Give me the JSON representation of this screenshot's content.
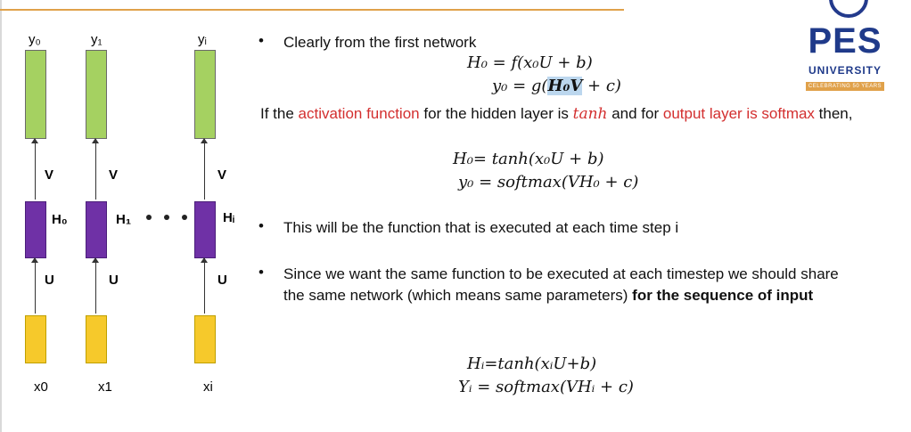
{
  "diagram": {
    "outputs": [
      "y₀",
      "y₁",
      "yᵢ"
    ],
    "weights_v": [
      "V",
      "V",
      "V"
    ],
    "hidden": [
      "H₀",
      "H₁",
      "Hᵢ"
    ],
    "weights_u": [
      "U",
      "U",
      "U"
    ],
    "inputs": [
      "x0",
      "x1",
      "xi"
    ],
    "colors": {
      "output": "#a5d161",
      "hidden": "#6f31a6",
      "input": "#f6c92b"
    }
  },
  "bullets": {
    "b1": "Clearly from the first network",
    "b2": "This will be the function that is executed at each time step i",
    "b3_normal": "Since we want the same function to be executed at each timestep we should share the same network (which means same parameters) ",
    "b3_bold": "for the sequence of input"
  },
  "equations": {
    "eq1": "H₀ = f(x₀U + b)",
    "eq2_pre": "y₀ = g(",
    "eq2_hl": "H₀V",
    "eq2_post": " + c)",
    "eq3": "H₀= tanh(x₀U + b)",
    "eq4": "y₀ = softmax(VH₀ + c)",
    "eq5": "Hᵢ=tanh(xᵢU+b)",
    "eq6": "Yᵢ = softmax(VHᵢ + c)"
  },
  "para": {
    "p1": "If the ",
    "p2": "activation function",
    "p3": " for the hidden layer is ",
    "p4": "tanh",
    "p5": " and for ",
    "p6": "output layer is softmax",
    "p7": " then,"
  },
  "logo": {
    "name": "PES",
    "sub": "UNIVERSITY",
    "tag": "CELEBRATING 50 YEARS"
  }
}
